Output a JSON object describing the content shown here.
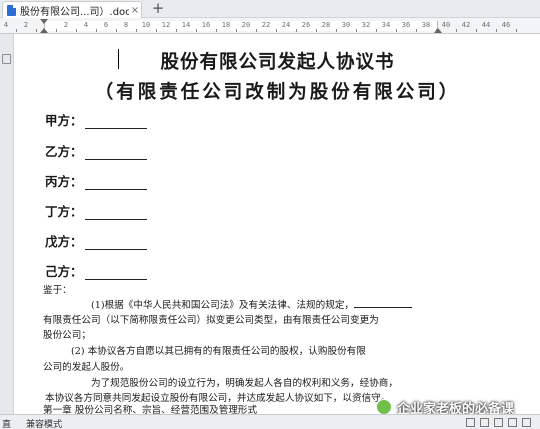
{
  "tab": {
    "title": "股份有限公司...司）.doc",
    "close": "×",
    "new": "+"
  },
  "ruler": {
    "numbers": [
      "4",
      "2",
      "",
      "2",
      "4",
      "6",
      "8",
      "10",
      "12",
      "14",
      "16",
      "18",
      "20",
      "22",
      "24",
      "26",
      "28",
      "30",
      "32",
      "34",
      "36",
      "38",
      "40",
      "42",
      "44",
      "46"
    ]
  },
  "document": {
    "title": "股份有限公司发起人协议书",
    "subtitle": "（有限责任公司改制为股份有限公司）",
    "parties": [
      "甲方：",
      "乙方：",
      "丙方：",
      "丁方：",
      "戊方：",
      "己方："
    ],
    "whereas": "鉴于：",
    "p1_a": "(1)根据《中华人民共和国公司法》及有关法律、法规的规定，",
    "p1_b": "有限责任公司（以下简称限责任公司）拟变更公司类型，由有限责任公司变更为",
    "p1_c": "股份公司；",
    "p2_a": "(2) 本协议各方自愿以其已拥有的有限责任公司的股权，认购股份有限",
    "p2_b": "公司的发起人股份。",
    "p3_a": "为了规范股份公司的设立行为，明确发起人各自的权利和义务，经协商，",
    "p3_b": "本协议各方同意共同发起设立股份有限公司，并达成发起人协议如下，以资信守。",
    "chapter1": "第一章    股份公司名称、宗旨、经营范围及管理形式"
  },
  "status": {
    "page": "直",
    "mode": "兼容模式"
  },
  "watermark": "企业家老板的必备课"
}
